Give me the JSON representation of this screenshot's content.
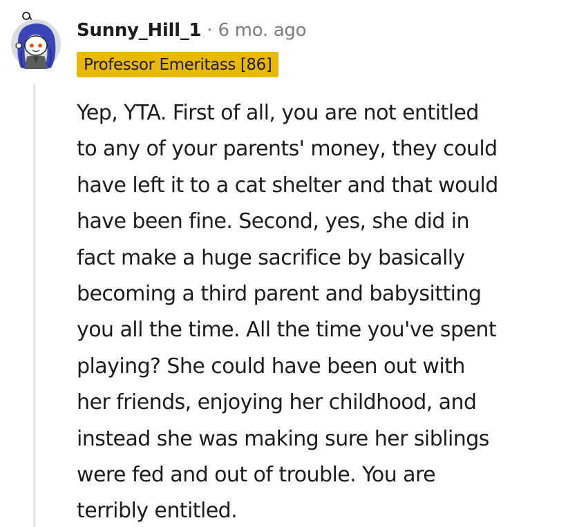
{
  "comment": {
    "author": "Sunny_Hill_1",
    "separator": "·",
    "timestamp": "6 mo. ago",
    "flair": "Professor Emeritass [86]",
    "flair_color": "#e8b900",
    "avatar_icon": "reddit-snoo-avatar",
    "body_lines": [
      "Yep, YTA. First of all, you are not entitled",
      "to any of your parents' money, they could",
      "have left it to a cat shelter and that would",
      "have been fine. Second, yes, she did in",
      "fact make a huge sacrifice by basically",
      "becoming a third parent and babysitting",
      "you all the time. All the time you've spent",
      "playing? She could have been out with",
      "her friends, enjoying her childhood, and",
      "instead she was making sure her siblings",
      "were fed and out of trouble. You are",
      "terribly entitled."
    ]
  }
}
